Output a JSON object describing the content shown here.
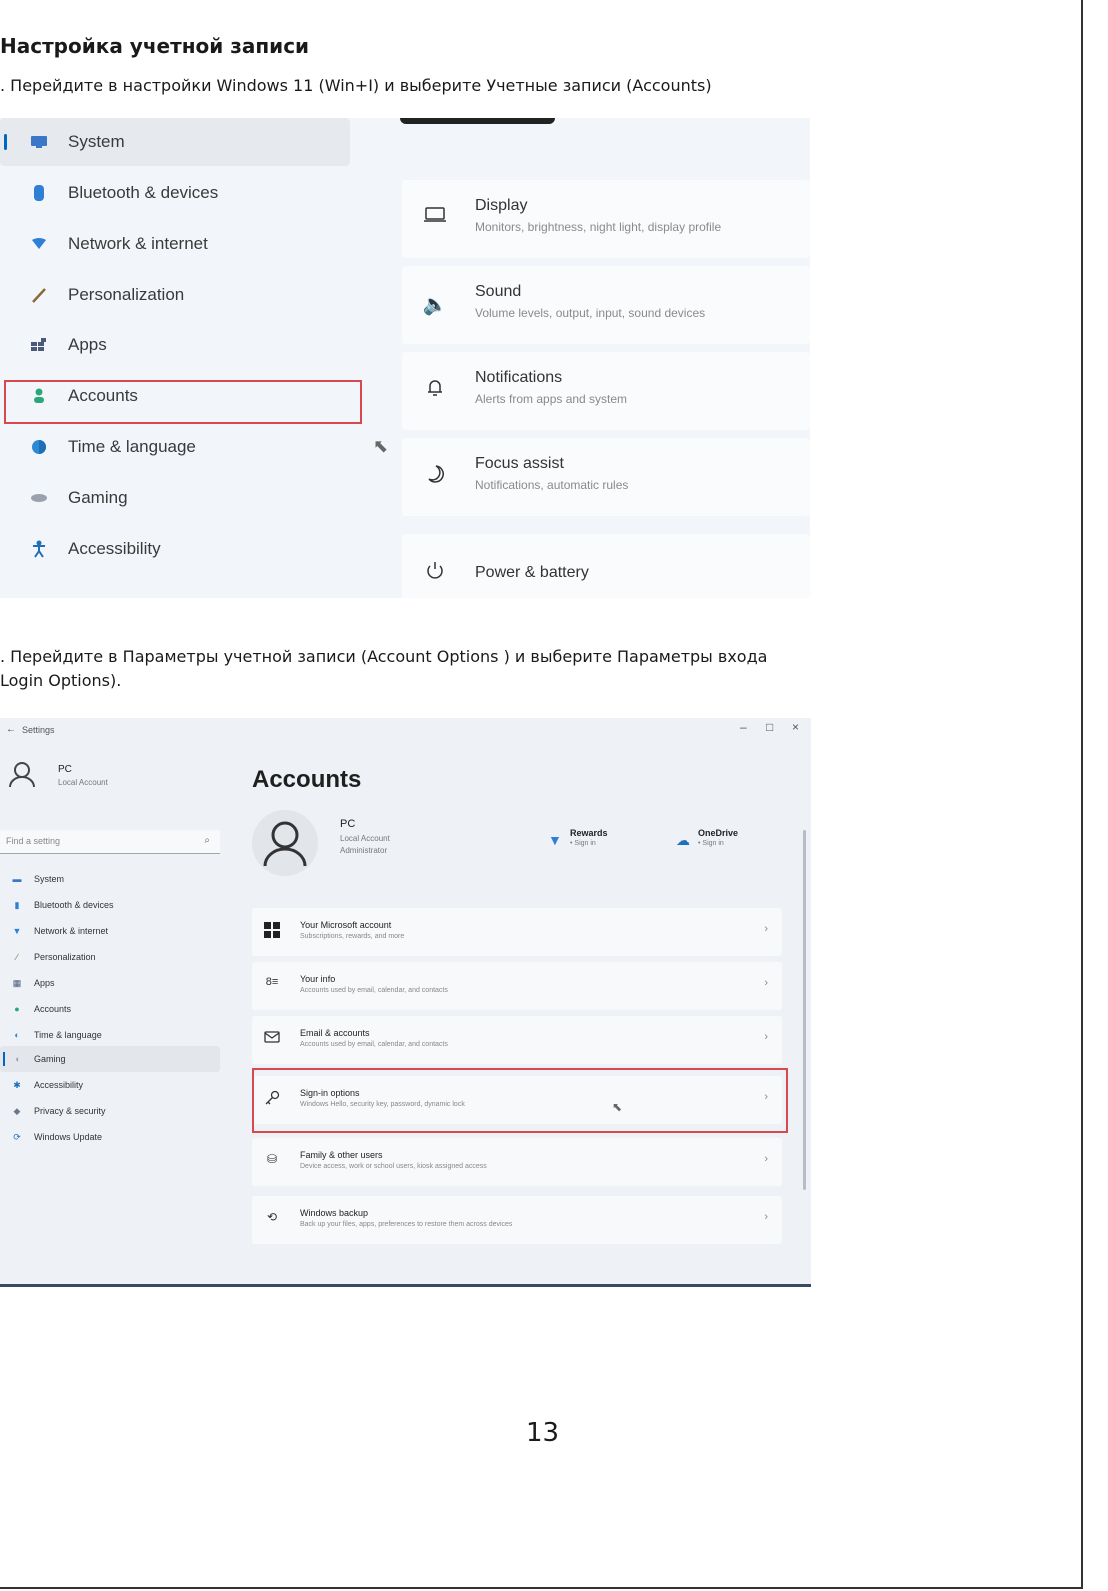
{
  "document": {
    "title": "Настройка учетной записи",
    "step1": ". Перейдите в настройки Windows 11 (Win+I) и выберите  Учетные записи  (Accounts)",
    "step2_line1": ". Перейдите в  Параметры учетной записи (Account Options ) и выберите Параметры входа",
    "step2_line2": "Login Options).",
    "page_number": "13"
  },
  "screenshot1": {
    "nav_items": [
      {
        "label": "System",
        "icon": "monitor-icon"
      },
      {
        "label": "Bluetooth & devices",
        "icon": "bluetooth-icon"
      },
      {
        "label": "Network & internet",
        "icon": "wifi-icon"
      },
      {
        "label": "Personalization",
        "icon": "brush-icon"
      },
      {
        "label": "Apps",
        "icon": "apps-icon"
      },
      {
        "label": "Accounts",
        "icon": "person-icon"
      },
      {
        "label": "Time & language",
        "icon": "globe-icon"
      },
      {
        "label": "Gaming",
        "icon": "gamepad-icon"
      },
      {
        "label": "Accessibility",
        "icon": "accessibility-icon"
      }
    ],
    "cards": [
      {
        "title": "Display",
        "subtitle": "Monitors, brightness, night light, display profile",
        "icon": "display-icon"
      },
      {
        "title": "Sound",
        "subtitle": "Volume levels, output, input, sound devices",
        "icon": "speaker-icon"
      },
      {
        "title": "Notifications",
        "subtitle": "Alerts from apps and system",
        "icon": "bell-icon"
      },
      {
        "title": "Focus assist",
        "subtitle": "Notifications, automatic rules",
        "icon": "moon-icon"
      },
      {
        "title": "Power & battery",
        "subtitle": "",
        "icon": "power-icon"
      }
    ]
  },
  "screenshot2": {
    "window_title": "Settings",
    "user": {
      "name": "PC",
      "subtitle": "Local Account"
    },
    "search_placeholder": "Find a setting",
    "nav_items": [
      {
        "label": "System"
      },
      {
        "label": "Bluetooth & devices"
      },
      {
        "label": "Network & internet"
      },
      {
        "label": "Personalization"
      },
      {
        "label": "Apps"
      },
      {
        "label": "Accounts"
      },
      {
        "label": "Time & language"
      },
      {
        "label": "Gaming"
      },
      {
        "label": "Accessibility"
      },
      {
        "label": "Privacy & security"
      },
      {
        "label": "Windows Update"
      }
    ],
    "page_title": "Accounts",
    "profile": {
      "name": "PC",
      "line1": "Local Account",
      "line2": "Administrator"
    },
    "services": [
      {
        "title": "Rewards",
        "subtitle": "• Sign in"
      },
      {
        "title": "OneDrive",
        "subtitle": "• Sign in"
      }
    ],
    "cards": [
      {
        "title": "Your Microsoft account",
        "subtitle": "Subscriptions, rewards, and more"
      },
      {
        "title": "Your info",
        "subtitle": "Accounts used by email, calendar, and contacts"
      },
      {
        "title": "Email & accounts",
        "subtitle": "Accounts used by email, calendar, and contacts"
      },
      {
        "title": "Sign-in options",
        "subtitle": "Windows Hello, security key, password, dynamic lock"
      },
      {
        "title": "Family & other users",
        "subtitle": "Device access, work or school users, kiosk assigned access"
      },
      {
        "title": "Windows backup",
        "subtitle": "Back up your files, apps, preferences to restore them across devices"
      }
    ],
    "colors": {
      "accent": "#0067c0",
      "highlight": "#d8484f"
    }
  }
}
